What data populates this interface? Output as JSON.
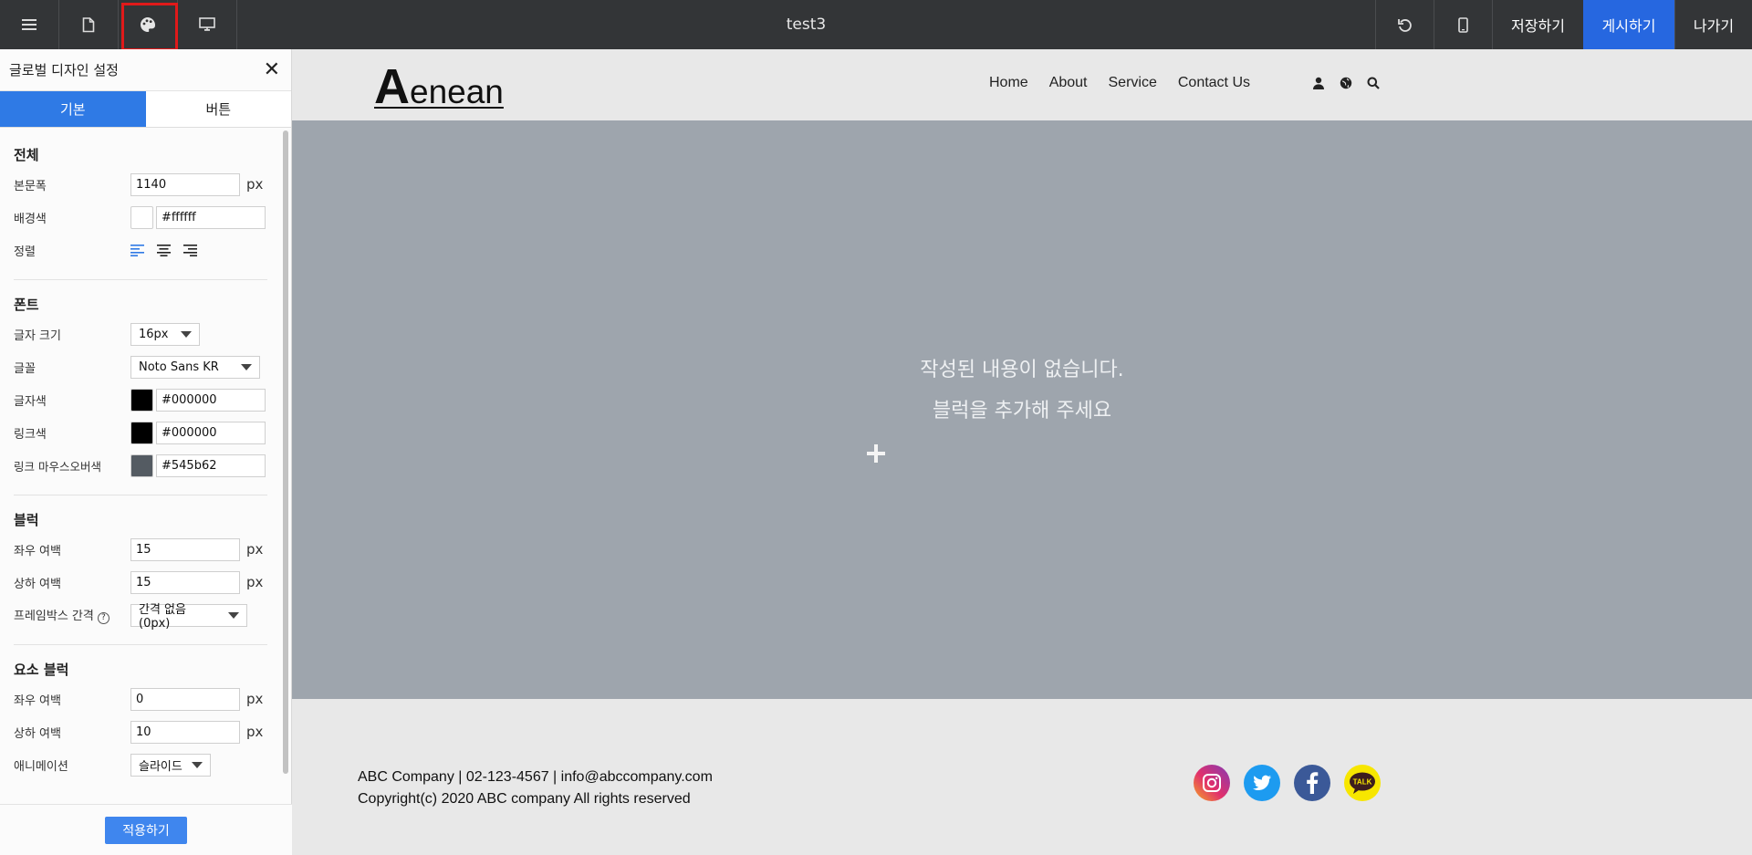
{
  "topbar": {
    "title": "test3",
    "buttons": [
      "menu-icon",
      "page-icon",
      "palette-icon",
      "monitor-icon"
    ],
    "save_label": "저장하기",
    "publish_label": "게시하기",
    "exit_label": "나가기"
  },
  "panel": {
    "title": "글로벌 디자인 설정",
    "tabs": [
      {
        "label": "기본"
      },
      {
        "label": "버튼"
      }
    ],
    "general": {
      "title": "전체",
      "width_label": "본문폭",
      "width_value": "1140",
      "unit": "px",
      "bg_label": "배경색",
      "bg_value": "#ffffff",
      "align_label": "정렬"
    },
    "font": {
      "title": "폰트",
      "size_label": "글자 크기",
      "size_value": "16px",
      "family_label": "글꼴",
      "family_value": "Noto Sans KR",
      "color_label": "글자색",
      "color_value": "#000000",
      "link_label": "링크색",
      "link_value": "#000000",
      "hover_label": "링크 마우스오버색",
      "hover_value": "#545b62"
    },
    "block": {
      "title": "블럭",
      "hpad_label": "좌우 여백",
      "hpad_value": "15",
      "vpad_label": "상하 여백",
      "vpad_value": "15",
      "gap_label": "프레임박스 간격",
      "gap_value": "간격 없음 (0px)"
    },
    "element": {
      "title": "요소 블럭",
      "hpad_label": "좌우 여백",
      "hpad_value": "0",
      "vpad_label": "상하 여백",
      "vpad_value": "10",
      "anim_label": "애니메이션",
      "anim_value": "슬라이드"
    },
    "apply_label": "적용하기"
  },
  "site": {
    "logo_big": "A",
    "logo_rest": "enean",
    "nav": [
      {
        "label": "Home"
      },
      {
        "label": "About"
      },
      {
        "label": "Service"
      },
      {
        "label": "Contact Us"
      }
    ],
    "empty_line1": "작성된 내용이 없습니다.",
    "empty_line2": "블럭을 추가해 주세요",
    "footer_line1": "ABC Company | 02-123-4567 | info@abccompany.com",
    "footer_line2": "Copyright(c) 2020 ABC company All rights reserved",
    "kakao_label": "TALK"
  },
  "colors": {
    "topbar": "#333537",
    "accent": "#2667e0",
    "hero": "#9ea5ad",
    "hover_swatch": "#545b62"
  }
}
